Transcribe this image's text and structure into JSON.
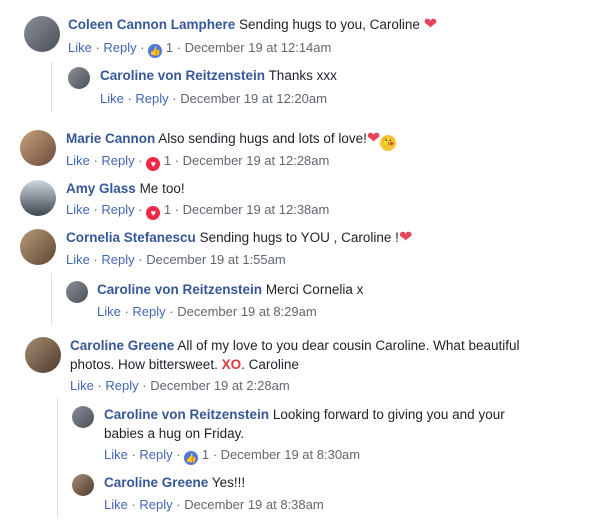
{
  "common": {
    "like": "Like",
    "reply": "Reply",
    "sep": " · ",
    "bullet": "·"
  },
  "comments": [
    {
      "name": "Coleen Cannon Lamphere",
      "text": "Sending hugs to you, Caroline",
      "reaction_count": "1",
      "time": "December 19 at 12:14am"
    },
    {
      "name": "Caroline von Reitzenstein",
      "text": "Thanks xxx",
      "time": "December 19 at 12:20am"
    },
    {
      "name": "Marie Cannon",
      "text": "Also sending hugs and lots of love!",
      "reaction_count": "1",
      "time": "December 19 at 12:28am"
    },
    {
      "name": "Amy Glass",
      "text": "Me too!",
      "reaction_count": "1",
      "time": "December 19 at 12:38am"
    },
    {
      "name": "Cornelia Stefanescu",
      "text": "Sending hugs to YOU , Caroline !",
      "time": "December 19 at 1:55am"
    },
    {
      "name": "Caroline von Reitzenstein",
      "text": "Merci Cornelia x",
      "time": "December 19 at 8:29am"
    },
    {
      "name": "Caroline Greene",
      "text_line1": "All of my love to you dear cousin Caroline. What beautiful",
      "text_line2a": "photos. How bittersweet.",
      "xo": "XO",
      "text_line2b": ". Caroline",
      "time": "December 19 at 2:28am"
    },
    {
      "name": "Caroline von Reitzenstein",
      "text_line1": "Looking forward to giving you and your",
      "text_line2": "babies a hug on Friday.",
      "reaction_count": "1",
      "time": "December 19 at 8:30am"
    },
    {
      "name": "Caroline Greene",
      "text": "Yes!!!",
      "time": "December 19 at 8:38am"
    }
  ]
}
